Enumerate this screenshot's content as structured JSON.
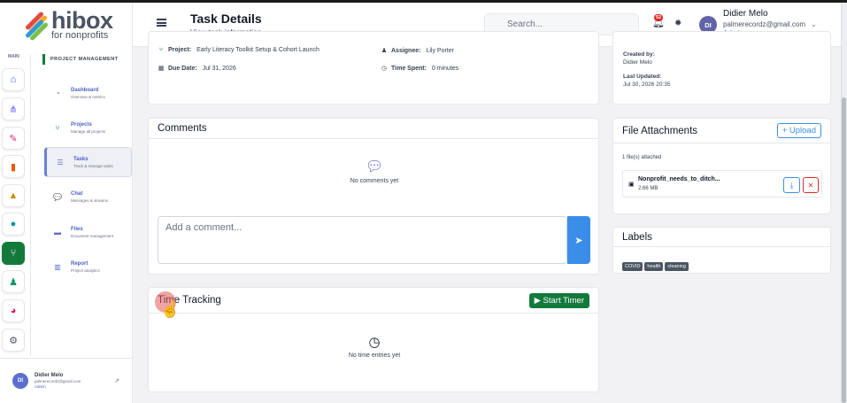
{
  "app": {
    "logo_text": "hibox",
    "logo_subtext": "for nonprofits"
  },
  "header": {
    "title": "Task Details",
    "subtitle": "View task information",
    "search_placeholder": "Search...",
    "notification_count": "52",
    "user": {
      "initials": "DI",
      "name": "Didier Melo",
      "email": "palmerecordz@gmail.com",
      "role": "Admin"
    }
  },
  "sidebar": {
    "rail_label": "MAIN",
    "section_title": "PROJECT MANAGEMENT",
    "items": [
      {
        "label": "Dashboard",
        "sub": "Overview & metrics",
        "icon": "dashboard-icon",
        "glyph": "◔"
      },
      {
        "label": "Projects",
        "sub": "Manage all projects",
        "icon": "projects-icon",
        "glyph": "⑂"
      },
      {
        "label": "Tasks",
        "sub": "Track & manage tasks",
        "icon": "tasks-icon",
        "glyph": "☰"
      },
      {
        "label": "Chat",
        "sub": "Messages & streams",
        "icon": "chat-icon",
        "glyph": "💬"
      },
      {
        "label": "Files",
        "sub": "Document management",
        "icon": "folder-icon",
        "glyph": "▬"
      },
      {
        "label": "Report",
        "sub": "Project analytics",
        "icon": "report-icon",
        "glyph": "▥"
      }
    ],
    "rail": [
      {
        "icon": "home-icon",
        "glyph": "⌂",
        "color": "#2563eb"
      },
      {
        "icon": "org-chart-icon",
        "glyph": "⋔",
        "color": "#6366f1"
      },
      {
        "icon": "bandage-icon",
        "glyph": "✎",
        "color": "#db2777"
      },
      {
        "icon": "book-icon",
        "glyph": "▮",
        "color": "#ea580c"
      },
      {
        "icon": "graduation-icon",
        "glyph": "▲",
        "color": "#ca8a04"
      },
      {
        "icon": "circle-icon",
        "glyph": "●",
        "color": "#0891b2"
      },
      {
        "icon": "project-diagram-icon",
        "glyph": "⑂",
        "color": "#ffffff"
      },
      {
        "icon": "users-icon",
        "glyph": "♟",
        "color": "#059669"
      },
      {
        "icon": "pie-chart-icon",
        "glyph": "◕",
        "color": "#e11d48"
      },
      {
        "icon": "settings-icon",
        "glyph": "⚙",
        "color": "#4b5563"
      }
    ],
    "footer_user": {
      "initials": "DI",
      "name": "Didier Melo",
      "email": "palmerecordz@gmail.com",
      "role": "Admin"
    }
  },
  "task": {
    "project_label": "Project:",
    "project_value": "Early Literacy Toolkit Setup & Cohort Launch",
    "assignee_label": "Assignee:",
    "assignee_value": "Lily Porter",
    "due_label": "Due Date:",
    "due_value": "Jul 31, 2026",
    "time_label": "Time Spent:",
    "time_value": "0 minutes",
    "created_by_label": "Created by:",
    "created_by_value": "Didier Melo",
    "updated_label": "Last Updated:",
    "updated_value": "Jul 30, 2026 20:35"
  },
  "comments": {
    "title": "Comments",
    "empty": "No comments yet",
    "placeholder": "Add a comment..."
  },
  "time_tracking": {
    "title": "Time Tracking",
    "start_button": "Start Timer",
    "empty": "No time entries yet"
  },
  "attachments": {
    "title": "File Attachments",
    "upload_button": "Upload",
    "count_text": "1 file(s) attached",
    "files": [
      {
        "name": "Nonprofit_needs_to_ditch...",
        "size": "2.66 MB"
      }
    ]
  },
  "labels": {
    "title": "Labels",
    "tags": [
      "COVID",
      "health",
      "cleaning"
    ]
  }
}
